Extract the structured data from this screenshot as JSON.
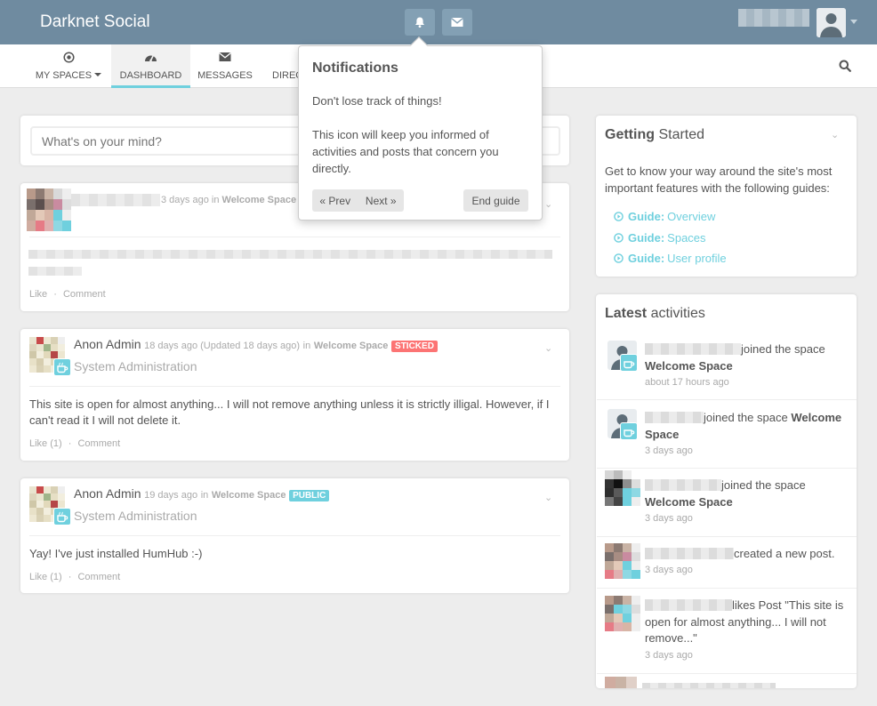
{
  "app": {
    "brand": "Darknet Social"
  },
  "topbar": {
    "notifications_icon": "bell-icon",
    "messages_icon": "envelope-icon"
  },
  "nav": {
    "items": [
      {
        "label": "MY SPACES",
        "icon": "dot-circle-icon"
      },
      {
        "label": "DASHBOARD",
        "icon": "dashboard-icon"
      },
      {
        "label": "MESSAGES",
        "icon": "envelope-icon"
      },
      {
        "label": "DIREC",
        "icon": "book-icon"
      }
    ]
  },
  "composer": {
    "placeholder": "What's on your mind?"
  },
  "posts": [
    {
      "time": "3 days ago",
      "in": "in",
      "space": "Welcome Space",
      "like": "Like",
      "comment": "Comment",
      "dot": "·"
    },
    {
      "author": "Anon Admin",
      "time": "18 days ago (Updated 18 days ago)",
      "in": "in",
      "space": "Welcome Space",
      "badge": "STICKED",
      "subtitle": "System Administration",
      "body": "This site is open for almost anything... I will not remove anything unless it is strictly illigal. However, if I can't read it I will not delete it.",
      "like": "Like (1)",
      "comment": "Comment",
      "dot": "·"
    },
    {
      "author": "Anon Admin",
      "time": "19 days ago",
      "in": "in",
      "space": "Welcome Space",
      "badge": "PUBLIC",
      "subtitle": "System Administration",
      "body": "Yay! I've just installed HumHub :-)",
      "like": "Like (1)",
      "comment": "Comment",
      "dot": "·"
    }
  ],
  "popover": {
    "title": "Notifications",
    "line1": "Don't lose track of things!",
    "line2": "This icon will keep you informed of activities and posts that concern you directly.",
    "prev": "« Prev",
    "next": "Next »",
    "end": "End guide"
  },
  "getting_started": {
    "title_bold": "Getting",
    "title_rest": "Started",
    "intro": "Get to know your way around the site's most important features with the following guides:",
    "guides": [
      {
        "prefix": "Guide:",
        "label": "Overview"
      },
      {
        "prefix": "Guide:",
        "label": "Spaces"
      },
      {
        "prefix": "Guide:",
        "label": "User profile"
      }
    ]
  },
  "activities": {
    "title_bold": "Latest",
    "title_rest": "activities",
    "items": [
      {
        "text": "joined the space",
        "bold": "Welcome Space",
        "time": "about 17 hours ago"
      },
      {
        "text": "joined the space",
        "bold": "Welcome Space",
        "time": "3 days ago"
      },
      {
        "text": "joined the space",
        "bold": "Welcome Space",
        "time": "3 days ago"
      },
      {
        "text": "created a new post.",
        "time": "3 days ago"
      },
      {
        "text": "likes Post \"This site is open for almost anything... I will not remove...\"",
        "time": "3 days ago"
      }
    ]
  },
  "colors": {
    "topbar": "#6f8ba0",
    "accent": "#6fd0de",
    "sticked": "#fc7474",
    "public": "#6fd0de"
  }
}
